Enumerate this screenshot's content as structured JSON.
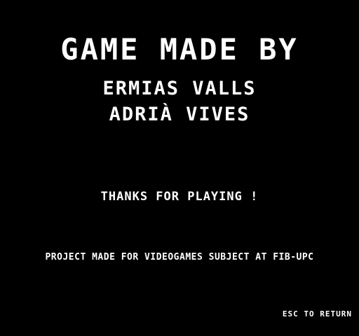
{
  "credits": {
    "title": "GAME MADE BY",
    "authors": [
      "ERMIAS VALLS",
      "ADRIÀ VIVES"
    ],
    "thanks": "THANKS FOR PLAYING !",
    "project": "PROJECT MADE FOR VIDEOGAMES SUBJECT AT FIB-UPC"
  },
  "controls": {
    "return_hint": "ESC TO RETURN"
  },
  "colors": {
    "background": "#000000",
    "text": "#ffffff"
  }
}
